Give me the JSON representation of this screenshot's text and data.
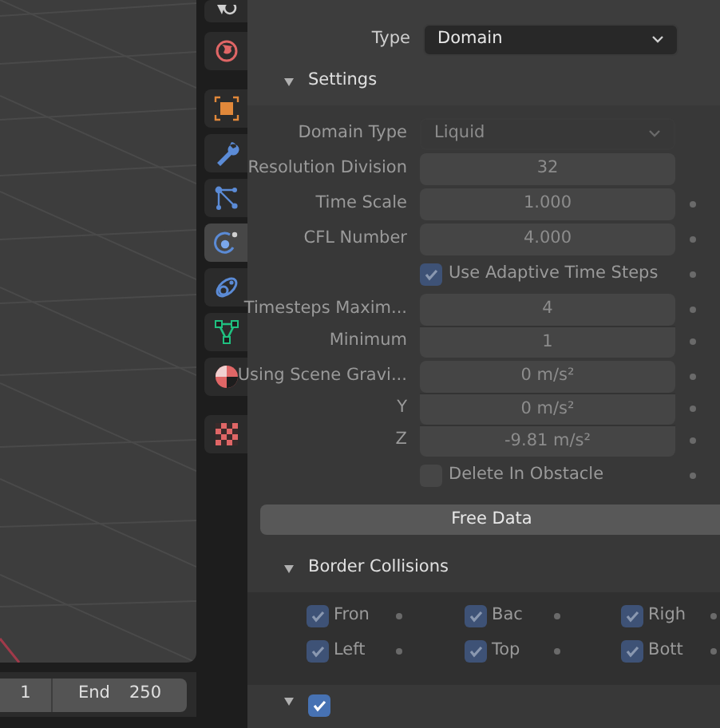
{
  "timeline": {
    "start_value": "1",
    "end_label": "End",
    "end_value": "250"
  },
  "tabs": [
    {
      "kind": "scene",
      "selected": false
    },
    {
      "kind": "world",
      "selected": false
    },
    {
      "kind": "object",
      "selected": false
    },
    {
      "kind": "modifier",
      "selected": false
    },
    {
      "kind": "particles",
      "selected": false
    },
    {
      "kind": "physics",
      "selected": true
    },
    {
      "kind": "constraints",
      "selected": false
    },
    {
      "kind": "data",
      "selected": false
    },
    {
      "kind": "material",
      "selected": false
    },
    {
      "kind": "texture",
      "selected": false
    }
  ],
  "fluid": {
    "type_label": "Type",
    "type_value": "Domain",
    "settings": {
      "title": "Settings",
      "expanded": true,
      "rows": [
        {
          "kind": "dropdown",
          "label": "Domain Type",
          "value": "Liquid",
          "disabled": true,
          "animatable": false,
          "joined": false
        },
        {
          "kind": "number",
          "label": "Resolution Division",
          "value": "32",
          "disabled": true,
          "animatable": false,
          "joined": false
        },
        {
          "kind": "number",
          "label": "Time Scale",
          "value": "1.000",
          "disabled": true,
          "animatable": true,
          "joined": false
        },
        {
          "kind": "number",
          "label": "CFL Number",
          "value": "4.000",
          "disabled": true,
          "animatable": true,
          "joined": false
        },
        {
          "kind": "checkbox",
          "label": "Use Adaptive Time Steps",
          "checked": true,
          "disabled": true,
          "animatable": true,
          "joined": false
        },
        {
          "kind": "number",
          "label": "Timesteps Maxim...",
          "value": "4",
          "disabled": true,
          "animatable": true,
          "joined": false
        },
        {
          "kind": "number",
          "label": "Minimum",
          "value": "1",
          "disabled": true,
          "animatable": true,
          "joined": true
        },
        {
          "kind": "number",
          "label": "Using Scene Gravi...",
          "value": "0 m/s²",
          "disabled": true,
          "animatable": true,
          "joined": false
        },
        {
          "kind": "number",
          "label": "Y",
          "value": "0 m/s²",
          "disabled": true,
          "animatable": true,
          "joined": true
        },
        {
          "kind": "number",
          "label": "Z",
          "value": "-9.81 m/s²",
          "disabled": true,
          "animatable": true,
          "joined": true
        },
        {
          "kind": "checkbox",
          "label": "Delete In Obstacle",
          "checked": false,
          "disabled": true,
          "animatable": true,
          "joined": false
        }
      ]
    },
    "free_data": "Free Data",
    "border": {
      "title": "Border Collisions",
      "expanded": true,
      "items": [
        {
          "label": "Fron",
          "checked": true,
          "disabled": true
        },
        {
          "label": "Bac",
          "checked": true,
          "disabled": true
        },
        {
          "label": "Righ",
          "checked": true,
          "disabled": true
        },
        {
          "label": "Left",
          "checked": true,
          "disabled": true
        },
        {
          "label": "Top",
          "checked": true,
          "disabled": true
        },
        {
          "label": "Bott",
          "checked": true,
          "disabled": true
        }
      ]
    },
    "next_panel": {
      "checked": true,
      "expanded": true
    }
  }
}
